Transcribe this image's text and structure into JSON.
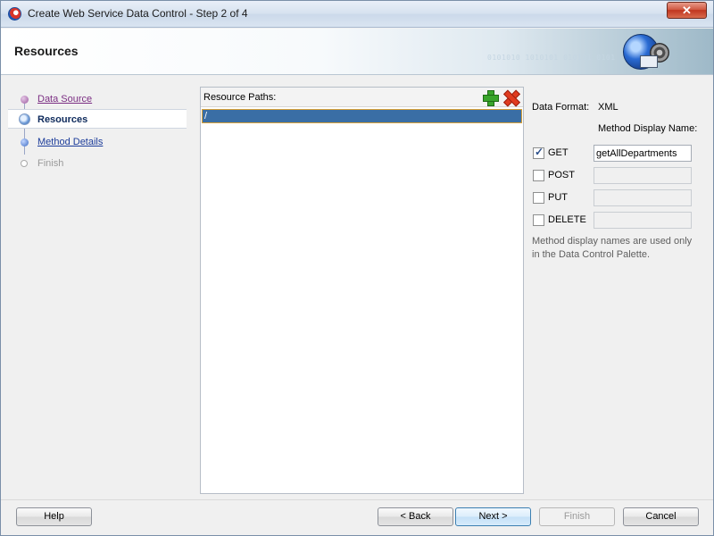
{
  "window": {
    "title": "Create Web Service Data Control - Step 2 of 4",
    "close_label": "✕"
  },
  "banner": {
    "title": "Resources",
    "binary_text": "0101010 1010101 010101 0101"
  },
  "nav": {
    "items": [
      {
        "label": "Data Source",
        "state": "visited"
      },
      {
        "label": "Resources",
        "state": "current"
      },
      {
        "label": "Method Details",
        "state": "link"
      },
      {
        "label": "Finish",
        "state": "disabled"
      }
    ]
  },
  "resources": {
    "header": "Resource Paths:",
    "add_icon": "add-icon",
    "delete_icon": "delete-icon",
    "rows": [
      "/"
    ]
  },
  "settings": {
    "data_format_label": "Data Format:",
    "data_format_value": "XML",
    "method_display_name_label": "Method Display Name:",
    "methods": [
      {
        "label": "GET",
        "checked": true,
        "value": "getAllDepartments"
      },
      {
        "label": "POST",
        "checked": false,
        "value": ""
      },
      {
        "label": "PUT",
        "checked": false,
        "value": ""
      },
      {
        "label": "DELETE",
        "checked": false,
        "value": ""
      }
    ],
    "note": "Method display names are used only in the Data Control Palette."
  },
  "buttons": {
    "help": "Help",
    "back": "< Back",
    "next": "Next >",
    "finish": "Finish",
    "cancel": "Cancel"
  }
}
